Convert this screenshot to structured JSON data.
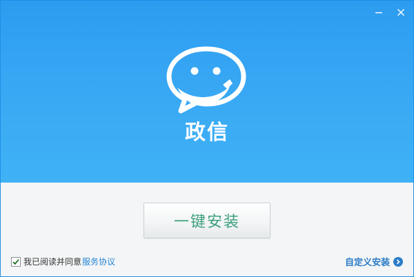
{
  "app": {
    "name": "政信"
  },
  "window_controls": {
    "minimize_icon": "minimize-icon",
    "close_icon": "close-icon"
  },
  "main": {
    "install_label": "一键安装"
  },
  "agreement": {
    "checked": true,
    "text": "我已阅读并同意",
    "link": "服务协议"
  },
  "custom_install": {
    "label": "自定义安装",
    "icon": "chevron-right-circle-icon"
  },
  "colors": {
    "header_top": "#2c9cf0",
    "header_bottom": "#3fb2f6",
    "install_text": "#3c9f7e",
    "link": "#2a86d8",
    "custom_install": "#2a7cc7"
  }
}
